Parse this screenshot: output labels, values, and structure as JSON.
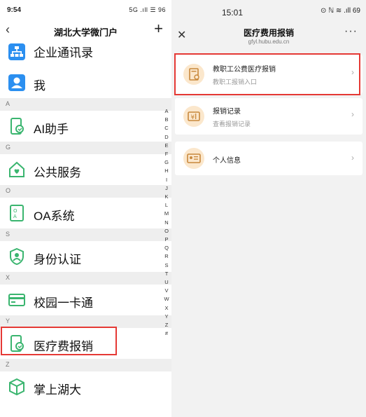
{
  "left": {
    "status_bar": {
      "time": "9:54",
      "indicators": "5G .ıll ☰ 96"
    },
    "nav": {
      "back_glyph": "‹",
      "title": "湖北大学微门户",
      "add_glyph": "+"
    },
    "rows": [
      {
        "label": "企业通讯录",
        "icon": "org-chart-icon"
      },
      {
        "label": "我",
        "icon": "person-icon"
      }
    ],
    "sections": [
      {
        "letter": "A",
        "item": {
          "label": "AI助手",
          "icon": "phone-hand-icon"
        }
      },
      {
        "letter": "G",
        "item": {
          "label": "公共服务",
          "icon": "house-heart-icon"
        }
      },
      {
        "letter": "O",
        "item": {
          "label": "OA系统",
          "icon": "oa-document-icon"
        }
      },
      {
        "letter": "S",
        "item": {
          "label": "身份认证",
          "icon": "shield-person-icon"
        }
      },
      {
        "letter": "X",
        "item": {
          "label": "校园一卡通",
          "icon": "card-icon"
        }
      },
      {
        "letter": "Y",
        "item": {
          "label": "医疗费报销",
          "icon": "phone-hand-icon"
        }
      },
      {
        "letter": "Z",
        "item": {
          "label": "掌上湖大",
          "icon": "cube-icon"
        }
      }
    ],
    "index_letters": [
      "A",
      "B",
      "C",
      "D",
      "E",
      "F",
      "G",
      "H",
      "I",
      "J",
      "K",
      "L",
      "M",
      "N",
      "O",
      "P",
      "Q",
      "R",
      "S",
      "T",
      "U",
      "V",
      "W",
      "X",
      "Y",
      "Z",
      "#"
    ]
  },
  "right": {
    "status_bar": {
      "time": "15:01",
      "indicators": "⊙ ℕ ≋ .ıll 69"
    },
    "nav": {
      "close_glyph": "✕",
      "title": "医疗费用报销",
      "url": "gfyl.hubu.edu.cn",
      "more_glyph": "···"
    },
    "cards": [
      {
        "title": "教职工公费医疗报销",
        "subtitle": "教职工报销入口",
        "icon": "document-person-icon"
      },
      {
        "title": "报销记录",
        "subtitle": "查看报销记录",
        "icon": "yen-ticket-icon"
      },
      {
        "title": "个人信息",
        "subtitle": "",
        "icon": "id-card-icon"
      }
    ],
    "chevron": "›"
  },
  "colors": {
    "accent_blue": "#2b8ff0",
    "accent_green": "#3ab56f",
    "highlight_red": "#e53935",
    "card_icon_bg": "#fbe7cc",
    "card_icon_fg": "#c8883c"
  }
}
